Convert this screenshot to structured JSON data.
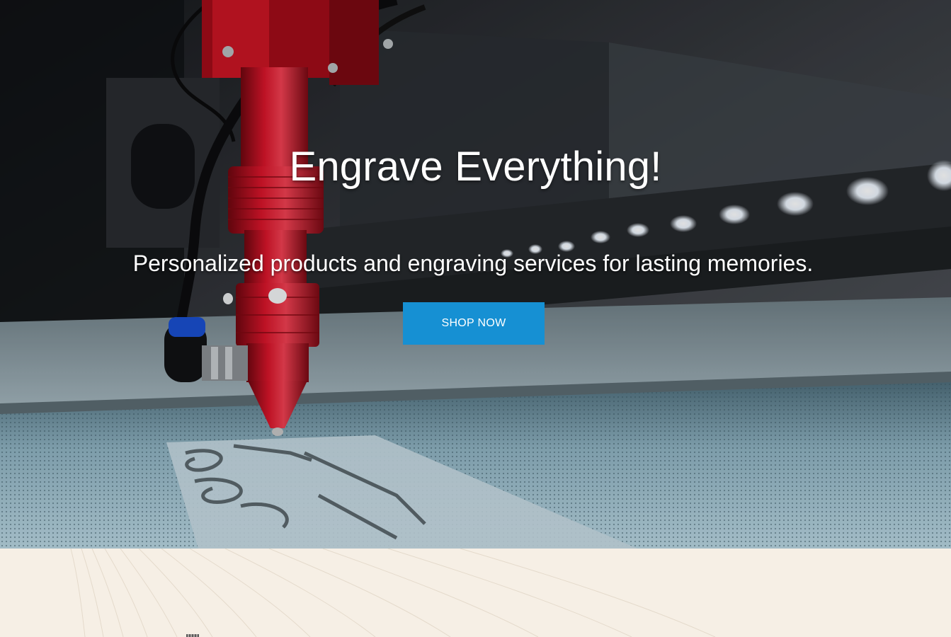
{
  "hero": {
    "title": "Engrave Everything!",
    "subtitle": "Personalized products and engraving services for lasting memories.",
    "cta_label": "SHOP NOW",
    "background_image": "laser-engraving-machine-photo"
  },
  "colors": {
    "cta_background": "#1690d3",
    "cta_text": "#ffffff",
    "hero_text": "#ffffff",
    "lower_background": "#f6efe5",
    "laser_head": "#c0121f"
  }
}
